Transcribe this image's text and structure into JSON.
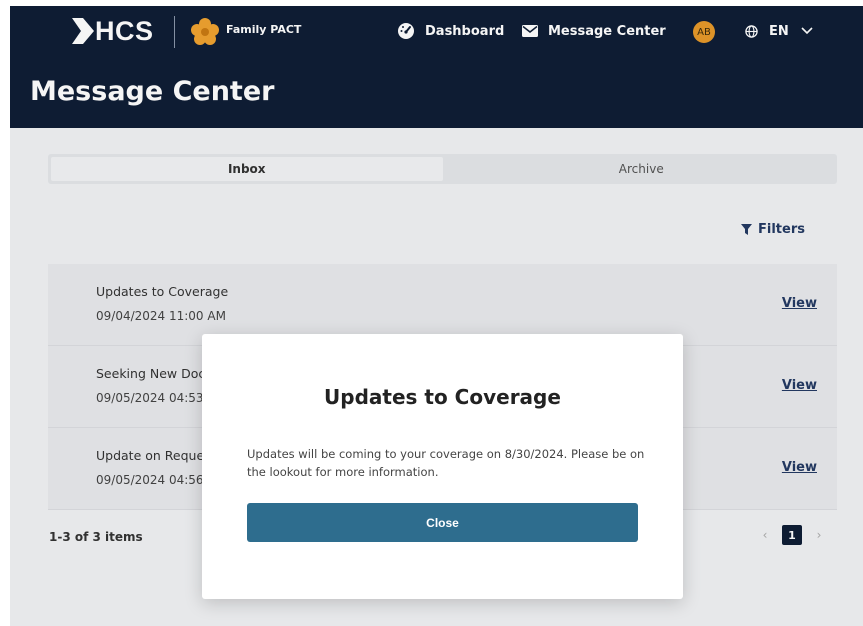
{
  "header": {
    "logo_text": "HCS",
    "program_name": "Family PACT",
    "nav": {
      "dashboard": "Dashboard",
      "message_center": "Message Center"
    },
    "avatar_initials": "AB",
    "language": "EN"
  },
  "page_title": "Message Center",
  "tabs": [
    {
      "label": "Inbox",
      "active": true
    },
    {
      "label": "Archive",
      "active": false
    }
  ],
  "filters_label": "Filters",
  "messages": [
    {
      "subject": "Updates to Coverage",
      "date": "09/04/2024 11:00 AM",
      "action": "View"
    },
    {
      "subject": "Seeking New Doc",
      "date": "09/05/2024 04:53",
      "action": "View"
    },
    {
      "subject": "Update on Reque",
      "date": "09/05/2024 04:56",
      "action": "View"
    }
  ],
  "pagination": {
    "summary": "1-3 of 3 items",
    "prev": "‹",
    "current_page": "1",
    "next": "›"
  },
  "modal": {
    "title": "Updates to Coverage",
    "body": "Updates will be coming to your coverage on 8/30/2024. Please be on the lookout for more information.",
    "close_label": "Close"
  },
  "colors": {
    "header_bg": "#0f1e36",
    "accent_button": "#2e6d8e",
    "link": "#243a63",
    "avatar": "#e79a2a",
    "flower": "#f0a330"
  },
  "icons": {
    "dashboard": "gauge-icon",
    "message_center": "envelope-icon",
    "language": "globe-icon",
    "dropdown": "chevron-down-icon",
    "filters": "funnel-icon"
  }
}
